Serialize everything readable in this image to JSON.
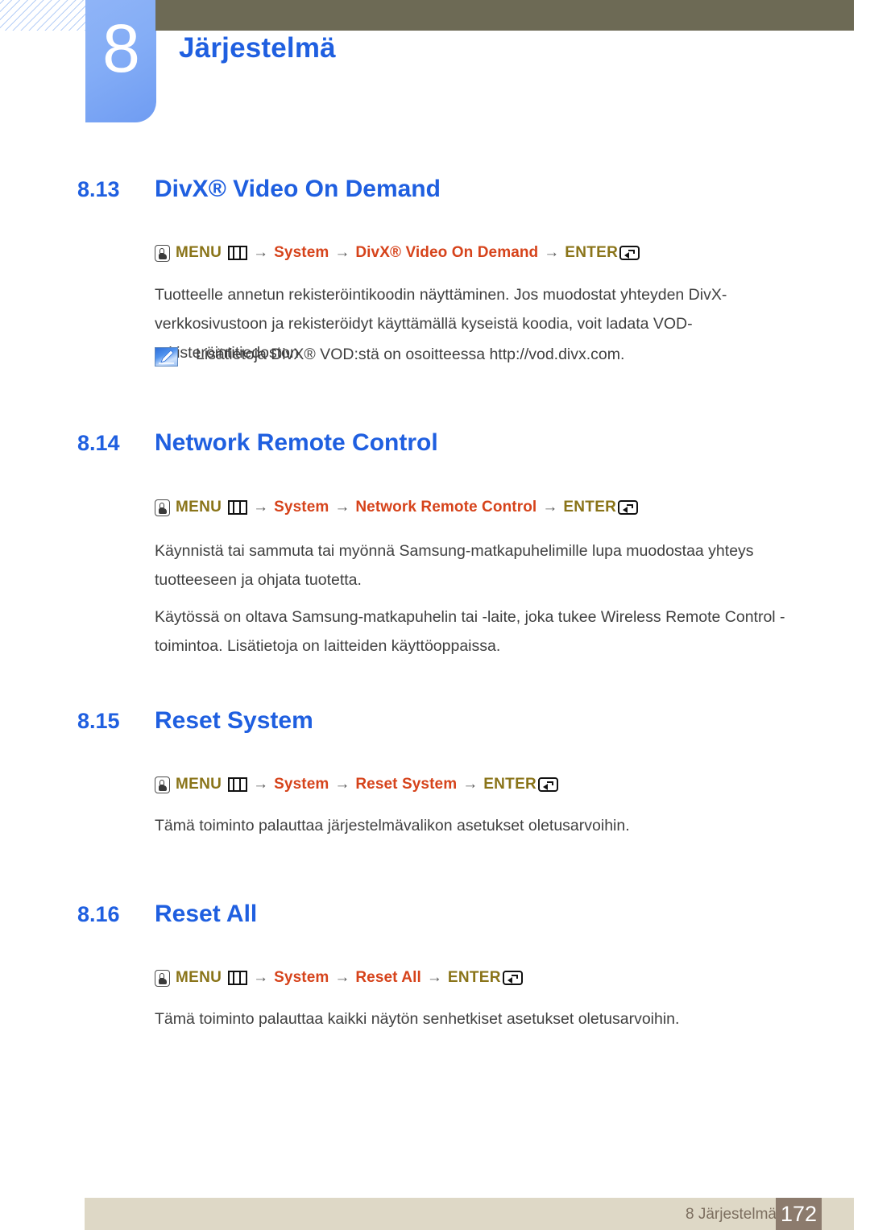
{
  "header": {
    "chapter_number": "8",
    "chapter_title": "Järjestelmä",
    "bar_color": "#6d6a55",
    "tab_color": "#84adf6",
    "title_color": "#1f5fe0"
  },
  "menu_label": "MENU",
  "enter_label": "ENTER",
  "arrow": "→",
  "sections": [
    {
      "number": "8.13",
      "title": "DivX® Video On Demand",
      "path": [
        "System",
        "DivX® Video On Demand"
      ],
      "body": "Tuotteelle annetun rekisteröintikoodin näyttäminen. Jos muodostat yhteyden DivX-verkkosivustoon ja rekisteröidyt käyttämällä kyseistä koodia, voit ladata VOD-rekisteröintitiedoston.",
      "note": "Lisätietoja DivX® VOD:stä on osoitteessa http://vod.divx.com."
    },
    {
      "number": "8.14",
      "title": "Network Remote Control",
      "path": [
        "System",
        "Network Remote Control"
      ],
      "body": "Käynnistä tai sammuta tai myönnä Samsung-matkapuhelimille lupa muodostaa yhteys tuotteeseen ja ohjata tuotetta.",
      "body2": "Käytössä on oltava Samsung-matkapuhelin tai -laite, joka tukee Wireless Remote Control -toimintoa. Lisätietoja on laitteiden käyttöoppaissa."
    },
    {
      "number": "8.15",
      "title": "Reset System",
      "path": [
        "System",
        "Reset System"
      ],
      "body": "Tämä toiminto palauttaa järjestelmävalikon asetukset oletusarvoihin."
    },
    {
      "number": "8.16",
      "title": "Reset All",
      "path": [
        "System",
        "Reset All"
      ],
      "body": "Tämä toiminto palauttaa kaikki näytön senhetkiset asetukset oletusarvoihin."
    }
  ],
  "footer": {
    "label": "8 Järjestelmä",
    "page_number": "172",
    "bar_color": "#ded8c6",
    "page_box_color": "#8c7b6d"
  },
  "colors": {
    "menu_keyword": "#8a7419",
    "menu_item": "#d6431b",
    "arrow": "#5b5b5b",
    "heading": "#1f5fe0",
    "body": "#3f3f3f"
  }
}
